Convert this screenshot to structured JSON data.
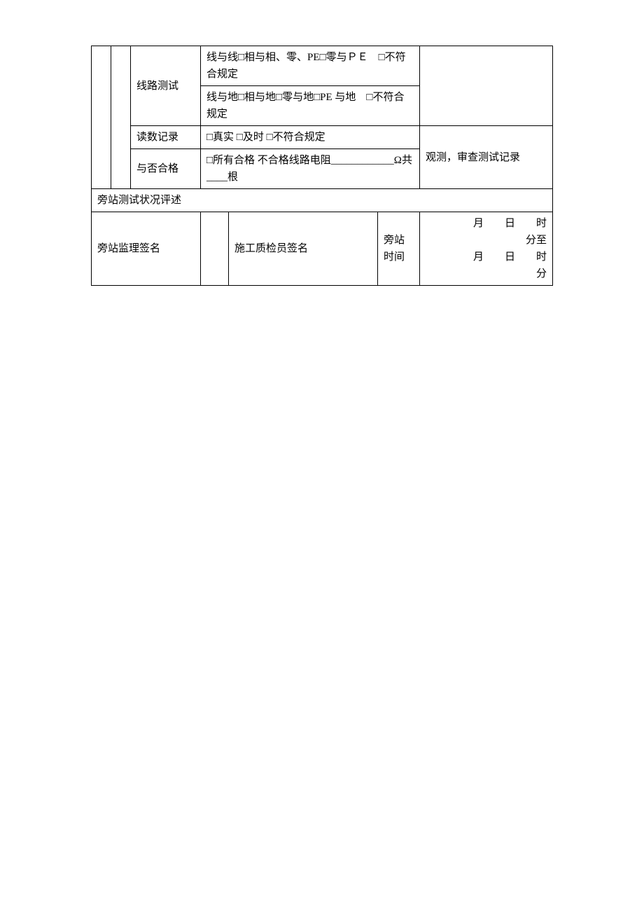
{
  "rows": {
    "r1": {
      "label": "线路测试",
      "line1": "线与线□相与相、零、PE□零与ＰＥ　□不符合规定",
      "line2": "线与地□相与地□零与地□PE 与地　□不符合规定"
    },
    "r2": {
      "label": "读数记录",
      "content": "□真实 □及时 □不符合规定"
    },
    "r3": {
      "label": "与否合格",
      "content": "□所有合格 不合格线路电阻____________Ω共____根",
      "right": "观测，审查测试记录"
    },
    "r4": {
      "label": "旁站测试状况评述"
    },
    "r5": {
      "sig1": "旁站监理签名",
      "sig2": "施工质检员签名",
      "time_label_top": "旁站",
      "time_label_bottom": "时间",
      "time_line1": "　　月　　日　　时　　分至",
      "time_line2": "　　　月　　日　　时　　　分"
    }
  }
}
